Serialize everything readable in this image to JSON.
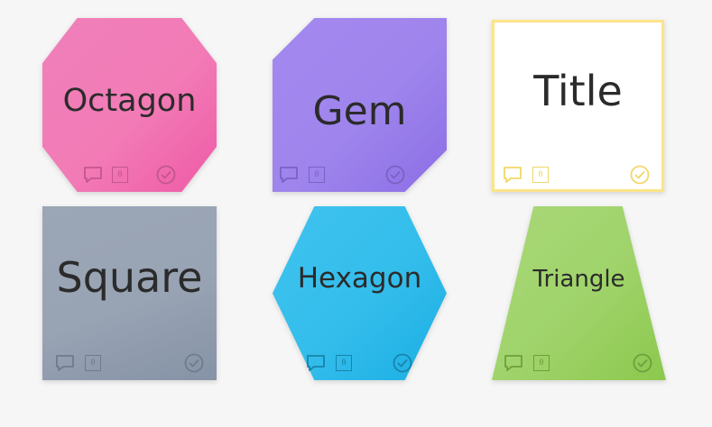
{
  "board": {
    "cards": [
      {
        "id": "octagon",
        "label": "Octagon",
        "shape": "octagon",
        "color": "#f07fb9",
        "icon_color": "#c2578d",
        "comment_count": "0"
      },
      {
        "id": "gem",
        "label": "Gem",
        "shape": "gem",
        "color": "#a389ef",
        "icon_color": "#7a62c4",
        "comment_count": "0"
      },
      {
        "id": "title",
        "label": "Title",
        "shape": "square",
        "color": "#ffffff",
        "border_color": "#fbe589",
        "icon_color": "#f2d867",
        "comment_count": "0"
      },
      {
        "id": "square",
        "label": "Square",
        "shape": "square",
        "color": "#9ba6b6",
        "icon_color": "#707b8c",
        "comment_count": "0"
      },
      {
        "id": "hexagon",
        "label": "Hexagon",
        "shape": "hexagon",
        "color": "#33bdeb",
        "icon_color": "#1784ab",
        "comment_count": "0"
      },
      {
        "id": "triangle",
        "label": "Triangle",
        "shape": "trapezoid",
        "color": "#9fd36a",
        "icon_color": "#6f9f3e",
        "comment_count": "0"
      }
    ],
    "icons": [
      "comment-icon",
      "counter-icon",
      "check-circle-icon"
    ]
  }
}
